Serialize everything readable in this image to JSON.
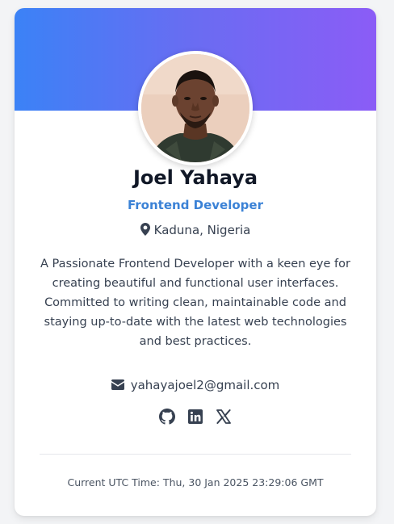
{
  "profile": {
    "name": "Joel Yahaya",
    "role": "Frontend Developer",
    "location": "Kaduna, Nigeria",
    "bio": "A Passionate Frontend Developer with a keen eye for creating beautiful and functional user interfaces. Committed to writing clean, maintainable code and staying up-to-date with the latest web technologies and best practices.",
    "email": "yahayajoel2@gmail.com"
  },
  "social": {
    "items": [
      {
        "icon": "github-icon"
      },
      {
        "icon": "linkedin-icon"
      },
      {
        "icon": "x-twitter-icon"
      }
    ]
  },
  "footer": {
    "time_text": "Current UTC Time: Thu, 30 Jan 2025 23:29:06 GMT"
  },
  "colors": {
    "gradient_start": "#3b82f6",
    "gradient_end": "#8b5cf6",
    "accent": "#3b82d6",
    "text_primary": "#111827",
    "text_body": "#374151"
  }
}
